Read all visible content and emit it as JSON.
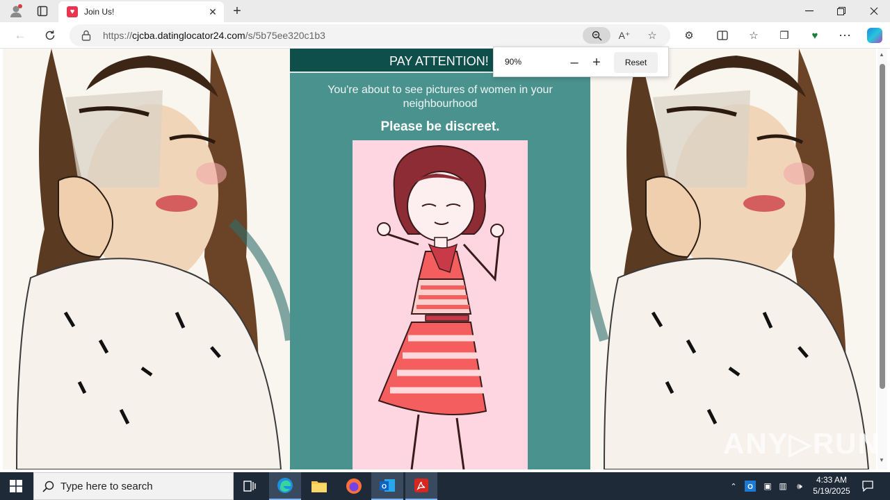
{
  "browser": {
    "tab_title": "Join Us!",
    "url_domain": "cjcba.datinglocator24.com",
    "url_prefix": "https://",
    "url_path": "/s/5b75ee320c1b3"
  },
  "zoom_popup": {
    "level": "90%",
    "reset_label": "Reset"
  },
  "page": {
    "header": "PAY ATTENTION!",
    "intro": "You're about to see pictures of women in your neighbourhood",
    "discreet": "Please be discreet."
  },
  "taskbar": {
    "search_placeholder": "Type here to search",
    "time": "4:33 AM",
    "date": "5/19/2025"
  },
  "watermark": "ANY RUN",
  "colors": {
    "header_bg": "#0e4f4c",
    "panel_bg": "#4a928d",
    "picture_bg": "#fdd6e2"
  }
}
